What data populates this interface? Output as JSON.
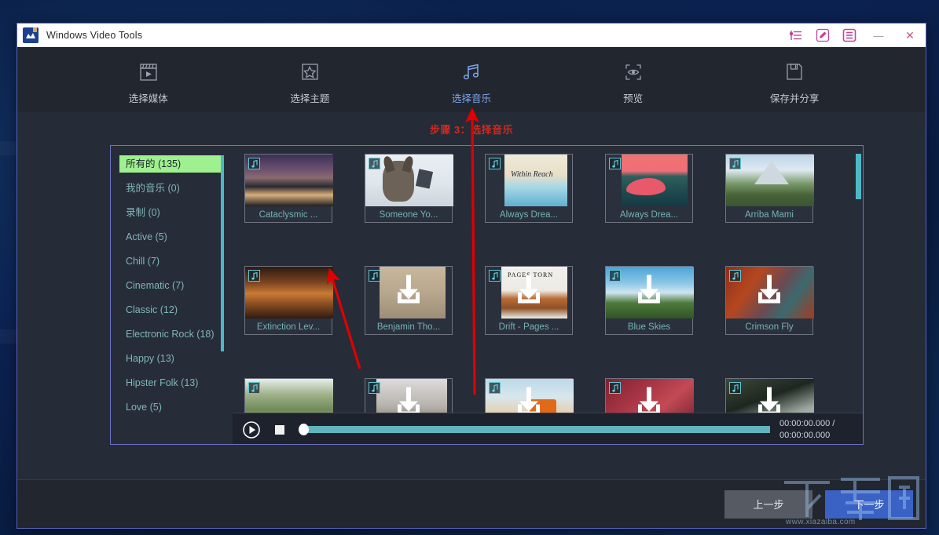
{
  "window": {
    "title": "Windows Video Tools",
    "app_icon": "mountain-logo-icon",
    "titlebar_icons": [
      {
        "name": "equalizer-icon",
        "label": "Settings list"
      },
      {
        "name": "edit-pencil-icon",
        "label": "Edit"
      },
      {
        "name": "menu-list-icon",
        "label": "Menu"
      }
    ],
    "minimize_label": "—",
    "close_label": "✕"
  },
  "steps": [
    {
      "label": "选择媒体",
      "icon": "film-clapper-icon",
      "active": false
    },
    {
      "label": "选择主题",
      "icon": "star-theme-icon",
      "active": false
    },
    {
      "label": "选择音乐",
      "icon": "music-note-icon",
      "active": true
    },
    {
      "label": "预览",
      "icon": "preview-eye-icon",
      "active": false
    },
    {
      "label": "保存并分享",
      "icon": "save-floppy-icon",
      "active": false
    }
  ],
  "step_title": "步骤 3：选择音乐",
  "sidebar": {
    "items": [
      {
        "label": "所有的 (135)",
        "selected": true
      },
      {
        "label": "我的音乐 (0)",
        "selected": false
      },
      {
        "label": "录制 (0)",
        "selected": false
      },
      {
        "label": "Active (5)",
        "selected": false
      },
      {
        "label": "Chill (7)",
        "selected": false
      },
      {
        "label": "Cinematic (7)",
        "selected": false
      },
      {
        "label": "Classic (12)",
        "selected": false
      },
      {
        "label": "Electronic Rock (18)",
        "selected": false
      },
      {
        "label": "Happy (13)",
        "selected": false
      },
      {
        "label": "Hipster Folk (13)",
        "selected": false
      },
      {
        "label": "Love (5)",
        "selected": false
      }
    ]
  },
  "tiles": [
    {
      "caption": "Cataclysmic ...",
      "badge": "music-note-icon",
      "download": false,
      "art": "city-night-skyline"
    },
    {
      "caption": "Someone Yo...",
      "badge": "music-note-icon",
      "download": false,
      "art": "husky-dog-snow"
    },
    {
      "caption": "Always Drea...",
      "badge": "music-note-icon",
      "download": false,
      "art": "within-reach-script"
    },
    {
      "caption": "Always Drea...",
      "badge": "music-note-icon",
      "download": false,
      "art": "pink-sunset-coast"
    },
    {
      "caption": "Arriba Mami",
      "badge": "music-note-icon",
      "download": false,
      "art": "green-mountain-peak"
    },
    {
      "caption": "Extinction Lev...",
      "badge": "music-note-icon",
      "download": false,
      "art": "campfire-branches"
    },
    {
      "caption": "Benjamin Tho...",
      "badge": "music-note-icon",
      "download": true,
      "art": "beige-portrait"
    },
    {
      "caption": "Drift - Pages ...",
      "badge": "music-note-icon",
      "download": true,
      "art": "pages-torn-cover"
    },
    {
      "caption": "Blue Skies",
      "badge": "music-note-icon",
      "download": true,
      "art": "blue-sky-field"
    },
    {
      "caption": "Crimson Fly",
      "badge": "music-note-icon",
      "download": true,
      "art": "crimson-red-scene"
    },
    {
      "caption": "",
      "badge": "music-note-icon",
      "download": false,
      "art": "palm-trees-beach"
    },
    {
      "caption": "",
      "badge": "music-note-icon",
      "download": true,
      "art": "person-hands-grey"
    },
    {
      "caption": "",
      "badge": "music-note-icon",
      "download": true,
      "art": "beach-orange-van"
    },
    {
      "caption": "",
      "badge": "music-note-icon",
      "download": true,
      "art": "red-rose-pattern"
    },
    {
      "caption": "",
      "badge": "music-note-icon",
      "download": true,
      "art": "dark-grey-leaves"
    }
  ],
  "player": {
    "play_icon": "play-circle-icon",
    "stop_icon": "stop-square-icon",
    "current_time": "00:00:00.000 /",
    "total_time": "00:00:00.000",
    "progress_percent": 0
  },
  "footer": {
    "prev_label": "上一步",
    "next_label": "下一步"
  },
  "watermark": {
    "logo": "下载吧",
    "url": "www.xiazaiba.com"
  },
  "colors": {
    "accent_blue": "#3a62c4",
    "step_active": "#7fa6e8",
    "step_title_red": "#d02a1f",
    "category_text": "#7fb7b6",
    "selected_green": "#9ff08e",
    "teal": "#5fb4be",
    "titlebar_icon_pink": "#c2439a",
    "annotation_red": "#e00000"
  }
}
